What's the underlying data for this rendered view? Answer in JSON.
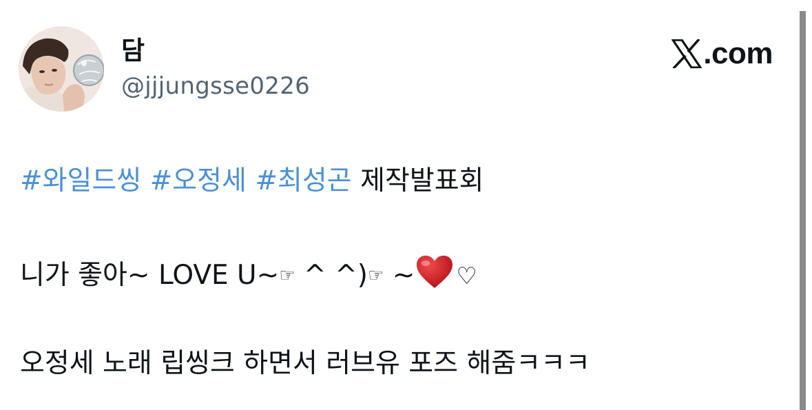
{
  "author": {
    "display_name": "담",
    "handle": "@jjjungsse0226"
  },
  "brand": {
    "label": ".com",
    "icon": "x-logo-icon"
  },
  "tweet": {
    "line1": {
      "hashtags": [
        "#와일드씽",
        "#오정세",
        "#최성곤"
      ],
      "text": "제작발표회"
    },
    "line2": {
      "text_before": "니가 좋아~ LOVE U~",
      "hand1": "☞",
      "mid": " ^ ^)",
      "hand2": "☞",
      "tilde": " ~",
      "heart_icon": "red-heart-icon",
      "white_heart": "♡"
    },
    "line3": {
      "text": "오정세 노래 립씽크 하면서 러브유 포즈 해줌ㅋㅋㅋ"
    }
  },
  "colors": {
    "hashtag": "#4b90d4",
    "handle": "#536471",
    "text": "#0f1419",
    "heart": "#d81f26"
  }
}
